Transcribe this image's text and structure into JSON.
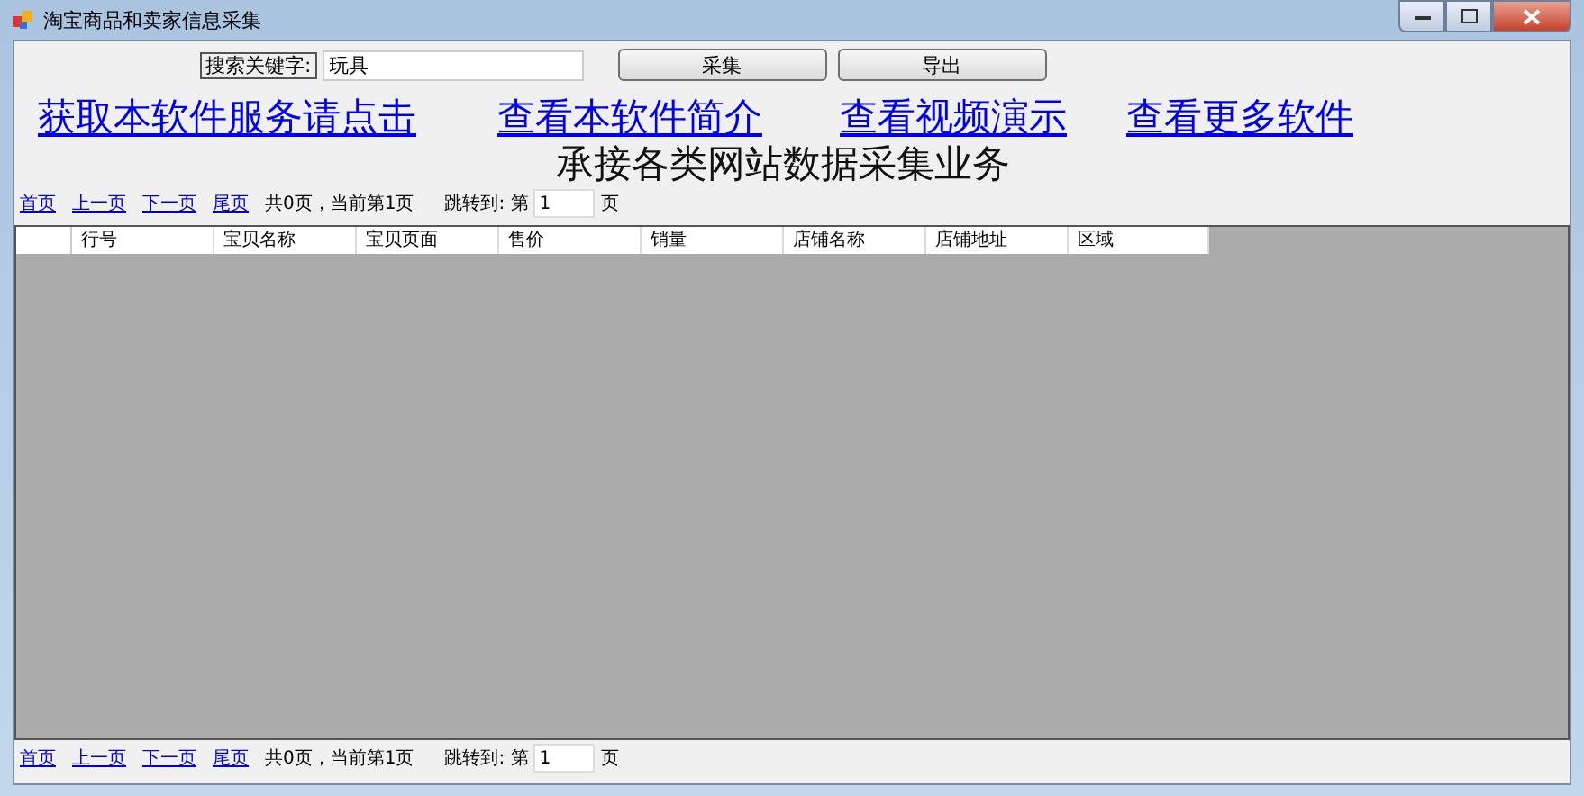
{
  "window": {
    "title": "淘宝商品和卖家信息采集"
  },
  "search": {
    "label": "搜索关键字:",
    "value": "玩具"
  },
  "buttons": [
    "采集",
    "导出"
  ],
  "links": [
    "获取本软件服务请点击",
    "查看本软件简介",
    "查看视频演示",
    "查看更多软件"
  ],
  "banner": "承接各类网站数据采集业务",
  "pagers": [
    {
      "links": [
        "首页",
        "上一页",
        "下一页",
        "尾页"
      ],
      "status": "共0页，当前第1页",
      "jump_label": "跳转到: 第",
      "page": "1",
      "unit": "页"
    },
    {
      "links": [
        "首页",
        "上一页",
        "下一页",
        "尾页"
      ],
      "status": "共0页，当前第1页",
      "jump_label": "跳转到: 第",
      "page": "1",
      "unit": "页"
    }
  ],
  "table": {
    "columns": [
      "行号",
      "宝贝名称",
      "宝贝页面",
      "售价",
      "销量",
      "店铺名称",
      "店铺地址",
      "区域"
    ]
  }
}
